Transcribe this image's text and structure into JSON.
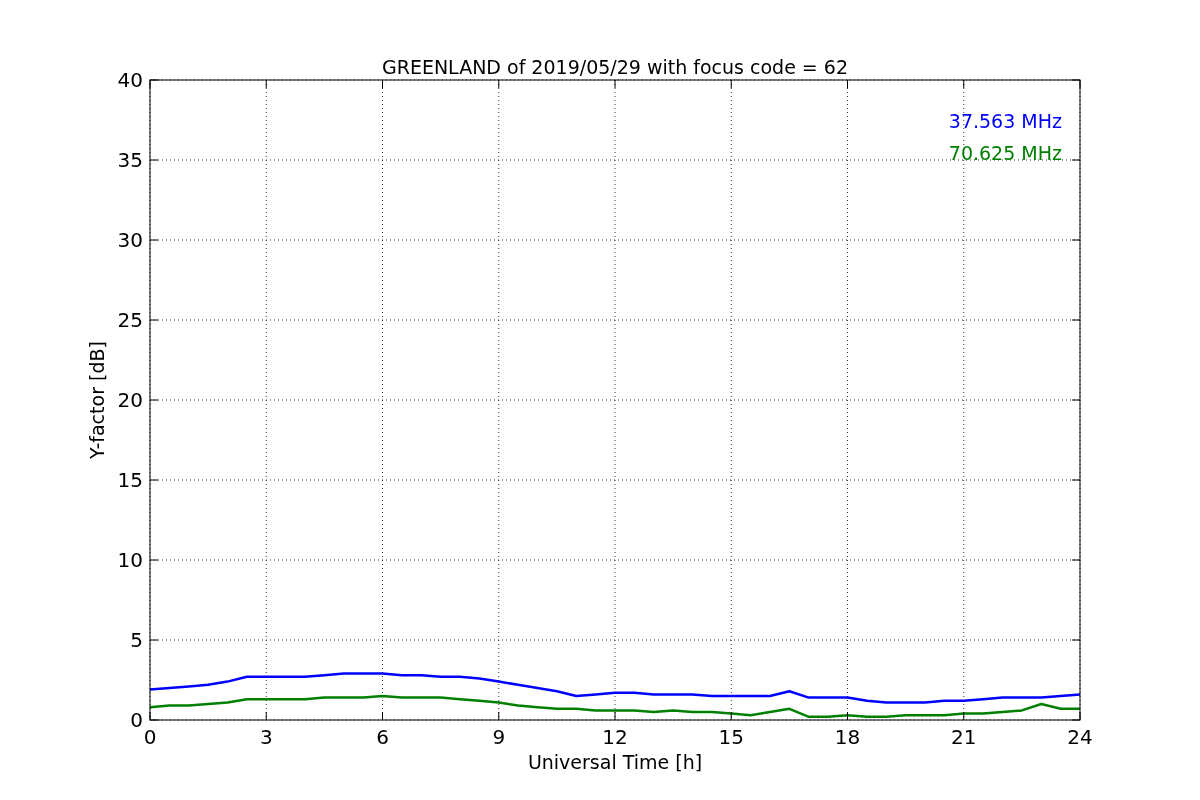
{
  "chart_data": {
    "type": "line",
    "title": "GREENLAND of 2019/05/29 with focus code = 62",
    "xlabel": "Universal Time [h]",
    "ylabel": "Y-factor [dB]",
    "x": [
      0,
      0.5,
      1,
      1.5,
      2,
      2.5,
      3,
      3.5,
      4,
      4.5,
      5,
      5.5,
      6,
      6.5,
      7,
      7.5,
      8,
      8.5,
      9,
      9.5,
      10,
      10.5,
      11,
      11.5,
      12,
      12.5,
      13,
      13.5,
      14,
      14.5,
      15,
      15.5,
      16,
      16.5,
      17,
      17.5,
      18,
      18.5,
      19,
      19.5,
      20,
      20.5,
      21,
      21.5,
      22,
      22.5,
      23,
      23.5,
      24
    ],
    "series": [
      {
        "name": "37.563 MHz",
        "color": "#0000ff",
        "values": [
          1.9,
          2.0,
          2.1,
          2.2,
          2.4,
          2.7,
          2.7,
          2.7,
          2.7,
          2.8,
          2.9,
          2.9,
          2.9,
          2.8,
          2.8,
          2.7,
          2.7,
          2.6,
          2.4,
          2.2,
          2.0,
          1.8,
          1.5,
          1.6,
          1.7,
          1.7,
          1.6,
          1.6,
          1.6,
          1.5,
          1.5,
          1.5,
          1.5,
          1.8,
          1.4,
          1.4,
          1.4,
          1.2,
          1.1,
          1.1,
          1.1,
          1.2,
          1.2,
          1.3,
          1.4,
          1.4,
          1.4,
          1.5,
          1.6
        ]
      },
      {
        "name": "70.625 MHz",
        "color": "#008000",
        "values": [
          0.8,
          0.9,
          0.9,
          1.0,
          1.1,
          1.3,
          1.3,
          1.3,
          1.3,
          1.4,
          1.4,
          1.4,
          1.5,
          1.4,
          1.4,
          1.4,
          1.3,
          1.2,
          1.1,
          0.9,
          0.8,
          0.7,
          0.7,
          0.6,
          0.6,
          0.6,
          0.5,
          0.6,
          0.5,
          0.5,
          0.4,
          0.3,
          0.5,
          0.7,
          0.2,
          0.2,
          0.3,
          0.2,
          0.2,
          0.3,
          0.3,
          0.3,
          0.4,
          0.4,
          0.5,
          0.6,
          1.0,
          0.7,
          0.7
        ]
      }
    ],
    "grid": true,
    "xlim": [
      0,
      24
    ],
    "ylim": [
      0,
      40
    ],
    "xticks": [
      0,
      3,
      6,
      9,
      12,
      15,
      18,
      21,
      24
    ],
    "yticks": [
      0,
      5,
      10,
      15,
      20,
      25,
      30,
      35,
      40
    ]
  }
}
